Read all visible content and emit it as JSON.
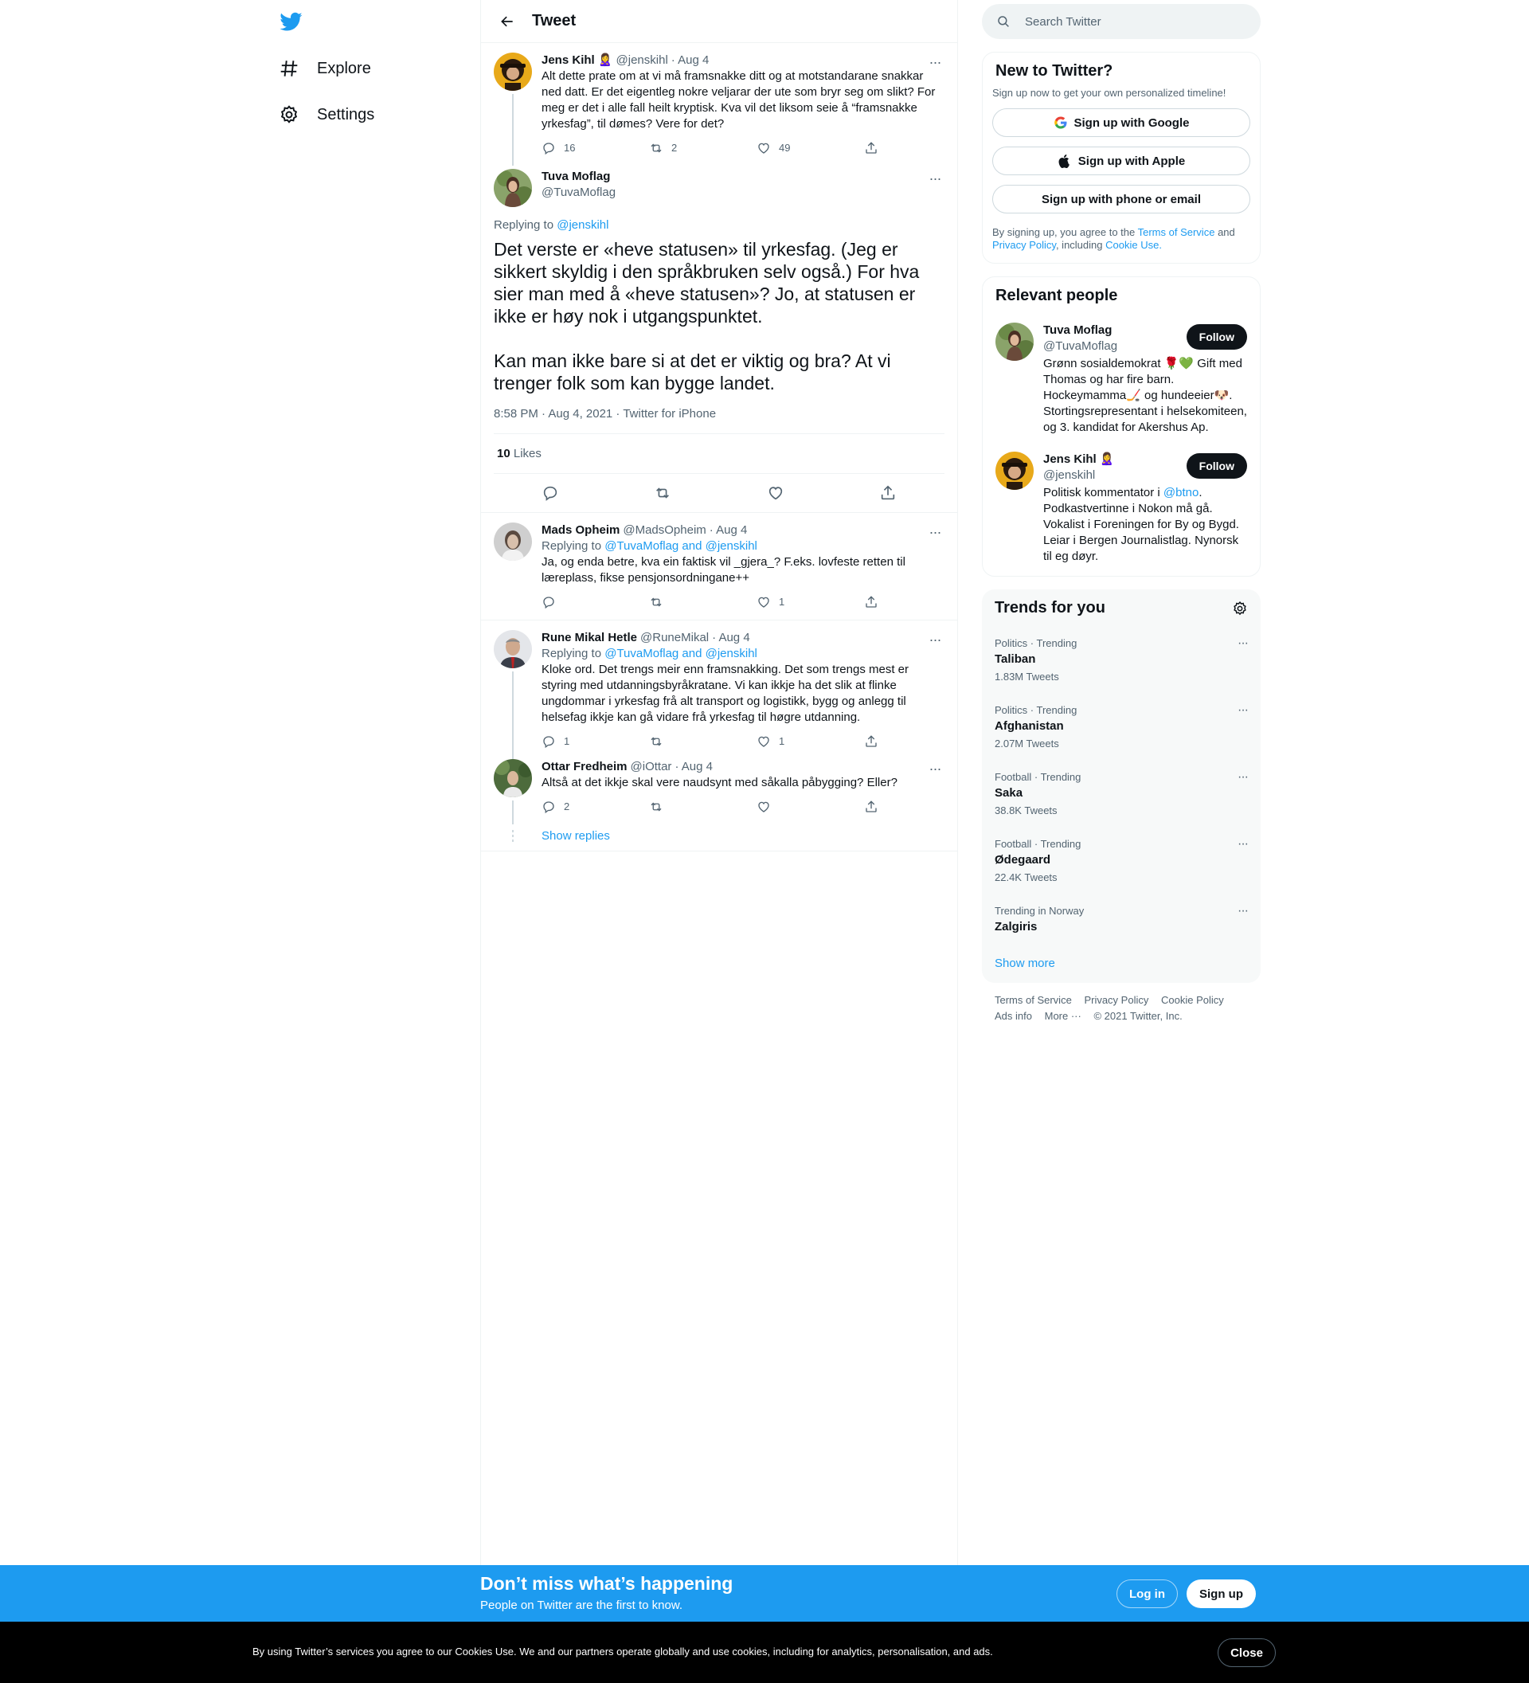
{
  "nav": {
    "items": [
      {
        "label": "Explore",
        "icon": "hashtag-icon"
      },
      {
        "label": "Settings",
        "icon": "gear-icon"
      }
    ]
  },
  "header": {
    "title": "Tweet"
  },
  "parent_tweet": {
    "name": "Jens Kihl 🙎‍♀️",
    "handle": "@jenskihl",
    "date": "· Aug 4",
    "text": "Alt dette prate om at vi må framsnakke ditt og at motstandarane snakkar ned datt. Er det eigentleg nokre veljarar der ute som bryr seg om slikt? For meg er det i alle fall heilt kryptisk. Kva vil det liksom seie å “framsnakke yrkesfag”, til dømes? Vere for det?",
    "replies": "16",
    "retweets": "2",
    "likes": "49"
  },
  "main_tweet": {
    "name": "Tuva Moflag",
    "handle": "@TuvaMoflag",
    "replying_label": "Replying to",
    "replying_to": "@jenskihl",
    "text": "Det verste er «heve statusen» til yrkesfag. (Jeg er sikkert skyldig i den språkbruken selv også.) For hva sier man med å «heve statusen»? Jo, at statusen er ikke er høy nok i utgangspunktet.\n\nKan man ikke bare si at det er viktig og bra? At vi trenger folk som kan bygge landet.",
    "timestamp": "8:58 PM · Aug 4, 2021 · Twitter for iPhone",
    "likes_count": "10",
    "likes_label": "Likes"
  },
  "replies": [
    {
      "name": "Mads Opheim",
      "handle": "@MadsOpheim",
      "date": "· Aug 4",
      "replying_label": "Replying to",
      "replying_to": "@TuvaMoflag and @jenskihl",
      "text": "Ja, og enda betre, kva ein faktisk vil _gjera_? F.eks. lovfeste retten til læreplass, fikse pensjonsordningane++",
      "replies": "",
      "retweets": "",
      "likes": "1"
    },
    {
      "name": "Rune Mikal Hetle",
      "handle": "@RuneMikal",
      "date": "· Aug 4",
      "replying_label": "Replying to",
      "replying_to": "@TuvaMoflag and @jenskihl",
      "text": "Kloke ord. Det trengs meir enn framsnakking. Det som trengs mest er styring med utdanningsbyråkratane. Vi kan ikkje ha det slik at flinke ungdommar i yrkesfag frå alt transport og logistikk, bygg og anlegg til helsefag    ikkje kan gå vidare frå yrkesfag til høgre utdanning.",
      "replies": "1",
      "retweets": "",
      "likes": "1"
    },
    {
      "name": "Ottar Fredheim",
      "handle": "@iOttar",
      "date": "· Aug 4",
      "text": "Altså at det ikkje skal vere naudsynt med såkalla påbygging? Eller?",
      "replies": "2",
      "retweets": "",
      "likes": ""
    }
  ],
  "show_replies": "Show replies",
  "search": {
    "placeholder": "Search Twitter"
  },
  "new_to_twitter": {
    "title": "New to Twitter?",
    "subtitle": "Sign up now to get your own personalized timeline!",
    "google": "Sign up with Google",
    "apple": "Sign up with Apple",
    "phone": "Sign up with phone or email",
    "fine_prefix": "By signing up, you agree to the",
    "terms": "Terms of Service",
    "and": "and",
    "privacy": "Privacy Policy",
    "including": ", including",
    "cookie": "Cookie Use."
  },
  "relevant_people": {
    "title": "Relevant people",
    "follow_label": "Follow",
    "people": [
      {
        "name": "Tuva Moflag",
        "handle": "@TuvaMoflag",
        "bio": "Grønn sosialdemokrat 🌹💚 Gift med Thomas og har fire barn. Hockeymamma🏒 og hundeeier🐶. Stortingsrepresentant i helsekomiteen, og 3. kandidat for Akershus Ap."
      },
      {
        "name": "Jens Kihl 🙎‍♀️",
        "handle": "@jenskihl",
        "bio_prefix": "Politisk kommentator i",
        "bio_link": "@btno",
        "bio_suffix": ". Podkastvertinne i Nokon må gå. Vokalist i Foreningen for By og Bygd. Leiar i Bergen Journalistlag. Nynorsk til eg døyr."
      }
    ]
  },
  "trends": {
    "title": "Trends for you",
    "items": [
      {
        "category": "Politics · Trending",
        "name": "Taliban",
        "count": "1.83M Tweets"
      },
      {
        "category": "Politics · Trending",
        "name": "Afghanistan",
        "count": "2.07M Tweets"
      },
      {
        "category": "Football · Trending",
        "name": "Saka",
        "count": "38.8K Tweets"
      },
      {
        "category": "Football · Trending",
        "name": "Ødegaard",
        "count": "22.4K Tweets"
      },
      {
        "category": "Trending in Norway",
        "name": "Zalgiris",
        "count": ""
      }
    ],
    "show_more": "Show more"
  },
  "footer": {
    "links": [
      "Terms of Service",
      "Privacy Policy",
      "Cookie Policy",
      "Ads info",
      "More ···"
    ],
    "copyright": "© 2021 Twitter, Inc."
  },
  "bottom_bar": {
    "title": "Don’t miss what’s happening",
    "subtitle": "People on Twitter are the first to know.",
    "login": "Log in",
    "signup": "Sign up"
  },
  "cookie_bar": {
    "text": "By using Twitter’s services you agree to our Cookies Use. We and our partners operate globally and use cookies, including for analytics, personalisation, and ads.",
    "close": "Close"
  },
  "colors": {
    "accent": "#1d9bf0",
    "text": "#0f1419",
    "secondary": "#536471",
    "border": "#eff3f4"
  }
}
